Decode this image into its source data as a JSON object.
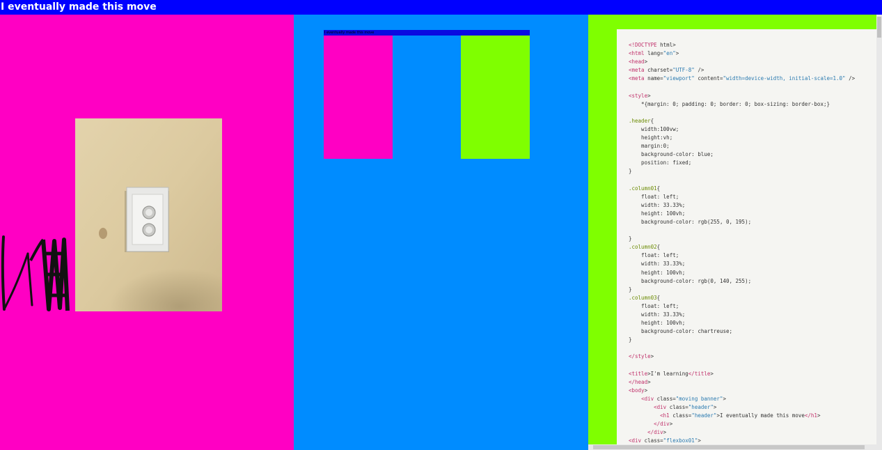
{
  "colors": {
    "header": "#0000ff",
    "column01": "#ff00c3",
    "column02": "#008cff",
    "column03": "#7fff00",
    "code_bg": "#f5f5f2",
    "code_tag": "#c0306a",
    "code_attr": "#6a8a00",
    "code_string": "#2a7ab0",
    "code_text": "#333333"
  },
  "header": {
    "title": "I eventually made this move"
  },
  "preview": {
    "header_text": "I eventually made this move"
  },
  "photo": {
    "icon": "light-switch-photo"
  },
  "code_lines": [
    "<!DOCTYPE html>",
    "<html lang=\"en\">",
    "<head>",
    "<meta charset=\"UTF-8\" />",
    "<meta name=\"viewport\" content=\"width=device-width, initial-scale=1.0\" />",
    "",
    "<style>",
    "    *{margin: 0; padding: 0; border: 0; box-sizing: border-box;}",
    "",
    ".header{",
    "    width:100vw;",
    "    height:vh;",
    "    margin:0;",
    "    background-color: blue;",
    "    position: fixed;",
    "}",
    "",
    ".column01{",
    "    float: left;",
    "    width: 33.33%;",
    "    height: 100vh;",
    "    background-color: rgb(255, 0, 195);",
    "",
    "}",
    ".column02{",
    "    float: left;",
    "    width: 33.33%;",
    "    height: 100vh;",
    "    background-color: rgb(0, 140, 255);",
    "}",
    ".column03{",
    "    float: left;",
    "    width: 33.33%;",
    "    height: 100vh;",
    "    background-color: chartreuse;",
    "}",
    "",
    "</style>",
    "",
    "<title>I'm learning</title>",
    "</head>",
    "<body>",
    "    <div class=\"moving banner\">",
    "        <div class=\"header\">",
    "          <h1 class=\"header\">I eventually made this move</h1>",
    "        </div>",
    "      </div>",
    "<div class=\"flexbox01\">"
  ]
}
